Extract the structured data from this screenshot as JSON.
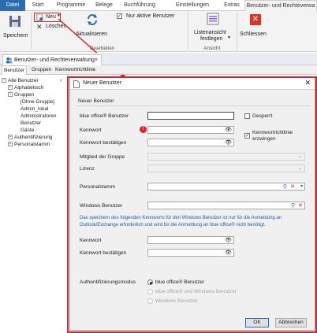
{
  "menu_tabs": [
    "Datei",
    "Start",
    "Programme",
    "Belege",
    "Buchführung",
    "Einstellungen",
    "Extras",
    "Benutzer- und Rechteverwa"
  ],
  "ribbon": {
    "save_label": "Speichern",
    "new_label": "Neu",
    "delete_label": "Löschen",
    "refresh_label": "Aktualisieren",
    "only_active_label": "Nur aktive Benutzer",
    "group_edit_label": "Bearbeiten",
    "list_view_label_1": "Listenansicht",
    "list_view_label_2": "festlegen",
    "group_view_label": "Ansicht",
    "close_label": "Schliessen"
  },
  "doc_tab": {
    "title": "Benutzer- und Rechteverwaltung",
    "close": "×"
  },
  "sub_tabs": [
    "Benutzer",
    "Gruppen",
    "Kennwortrichtlinie"
  ],
  "tree": {
    "root": "Alle Benutzer",
    "items": [
      "Alphabetisch",
      "Gruppen",
      "[Ohne Gruppe]",
      "Admin_lokal",
      "Administratoren",
      "Benutzer",
      "Gäste",
      "Authentifizierung",
      "Personalstamm"
    ]
  },
  "dialog": {
    "title": "Neuer Benutzer",
    "section": "Neuer Benutzer",
    "fields": {
      "user_label": "blue office® Benutzer",
      "locked_label": "Gesperrt",
      "password_label": "Kennwort",
      "password_confirm_label": "Kennwort bestätigen",
      "policy_label_1": "Kennwortrichtlinie",
      "policy_label_2": "erzwingen",
      "group_label": "Mitglied der Gruppe",
      "license_label": "Lizenz",
      "personnel_label": "Personalstamm",
      "windows_user_label": "Windows Benutzer",
      "info_text": "Das speichern des folgenden Kennworts für den Windows Benutzer ist nur für die Anmeldung an Outlook/Exchange erforderlich und wird für die Anmeldung an blue office® nicht benötigt.",
      "win_password_label": "Kennwort",
      "win_password_confirm_label": "Kennwort bestätigen",
      "auth_label": "Authentifizierungsmodus",
      "auth_options": [
        "blue office® Benutzer",
        "blue office® und Windows Benutzer",
        "Windows Benutzer"
      ]
    },
    "ok": "OK",
    "cancel": "Abbrechen"
  },
  "colors": {
    "accent": "#2b6cb0",
    "highlight": "#e0202a",
    "info_text": "#1f5fa8"
  }
}
